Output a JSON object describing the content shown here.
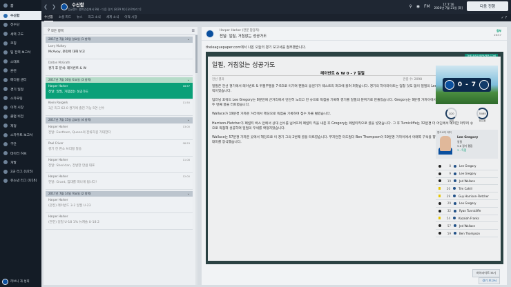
{
  "sidebar": {
    "top_label": "홈",
    "items": [
      {
        "label": "수신함",
        "icon": "inbox-icon",
        "active": true
      },
      {
        "label": "전수단",
        "icon": "squad-icon"
      },
      {
        "label": "세력 구도",
        "icon": "dynamics-icon"
      },
      {
        "label": "코칭",
        "icon": "whistle-icon"
      },
      {
        "label": "팀 전력 보고서",
        "icon": "report-icon"
      },
      {
        "label": "스태프",
        "icon": "staff-icon"
      },
      {
        "label": "훈련",
        "icon": "training-icon"
      },
      {
        "label": "메디컬 센터",
        "icon": "medical-icon"
      },
      {
        "label": "경기 일정",
        "icon": "calendar-icon"
      },
      {
        "label": "스카우팅",
        "icon": "scouting-icon"
      },
      {
        "label": "이적 시장",
        "icon": "transfers-icon"
      },
      {
        "label": "클럽 비전",
        "icon": "vision-icon"
      },
      {
        "label": "재정",
        "icon": "finance-icon"
      },
      {
        "label": "스카우트 보고서",
        "icon": "scout-report-icon"
      },
      {
        "label": "구단",
        "icon": "club-icon"
      },
      {
        "label": "데이터 허브",
        "icon": "data-icon"
      },
      {
        "label": "개발",
        "icon": "dev-icon"
      },
      {
        "label": "2군 리그 (U23)",
        "icon": "league-icon"
      },
      {
        "label": "유소년 리그 (U18)",
        "icon": "youth-league-icon"
      }
    ],
    "bottom_label": "리브니 과 성희"
  },
  "topbar": {
    "title": "수신함",
    "subtitle": "잉글랜드 챔피언십에서 8위 · 다음 경기 (8/29 화) [유로파리그]",
    "date_line1": "17:7:16",
    "date_line2": "2020년 7월 21일 [화]",
    "continue_label": "다음 진행"
  },
  "tabs": [
    "수신함",
    "소셜 피드",
    "뉴스",
    "리그 소식",
    "세계 소식",
    "이적 시장"
  ],
  "list": {
    "search_placeholder": "모든 항목",
    "groups": [
      {
        "header": "2017년 7월 16일 일요일 (1 항목)",
        "green": false,
        "messages": [
          {
            "sender": "Larry Mulkey",
            "subject": "McAvoy, 훈련에 대해 보고",
            "time": "",
            "read": false
          }
        ]
      },
      {
        "header": "",
        "green": false,
        "messages": [
          {
            "sender": "Dalton McGrath",
            "subject": "경기 후 분석: 레이번트 & W",
            "time": "",
            "read": false
          }
        ]
      },
      {
        "header": "2017년 7월 16일 토요일 (3 항목)",
        "green": true,
        "messages": [
          {
            "sender": "Harper Harker",
            "subject": "전달: 일필, 거침없는 성공가도",
            "time": "18:57",
            "read": false,
            "selected": true
          },
          {
            "sender": "Kevin Rosgerk",
            "subject": "3군 리그 62.0 경기에 출전 가능 5연 선수",
            "time": "11:50",
            "read": true
          }
        ]
      },
      {
        "header": "2017년 7월 15일 금요일 (4 항목)",
        "green": false,
        "messages": [
          {
            "sender": "Harper Harker",
            "subject": "전달: Eastham, Queen의 잔류하길 기대한다",
            "time": "13:00",
            "read": true
          },
          {
            "sender": "Paul Criver",
            "subject": "경기 전 펀소 브리핑 발송",
            "time": "08:53",
            "read": true
          },
          {
            "sender": "Harper Harker",
            "subject": "전달: Sheridan, 전방한 만큼 대표",
            "time": "11:08",
            "read": true
          },
          {
            "sender": "Harper Harker",
            "subject": "전달: Grant, 임대를 떠나게 됩니다!",
            "time": "12:00",
            "read": true
          }
        ]
      },
      {
        "header": "2017년 7월 14일 목요일 (2 항목)",
        "green": false,
        "messages": [
          {
            "sender": "Harper Harker",
            "subject": "(관전) 레이번드 3-2 일필 U-23",
            "time": "",
            "read": true
          },
          {
            "sender": "Harper Harker",
            "subject": "(관전) 일필 U-18 1% 뉴캐슬 U-18 2",
            "time": "",
            "read": true
          }
        ]
      }
    ]
  },
  "detail": {
    "from": "Harper Harker (전문 담당자)",
    "subject": "전달: 일필, 거침없는 성공가도",
    "attached_label": "첨부",
    "time": "16:57",
    "intro": "theleaguepaper.com에서 나온 오늘의 경기 보고서를 첨부했습니다.",
    "site_tag": "THELEAGUEPAPER.COM",
    "headline": "일필, 거침없는 성공가도",
    "score_line": "레이번트 & W 0 - 7 일필",
    "byline": "전선 결과",
    "rating_label": "관중 수: 2098",
    "paragraphs": [
      "일필은 전선 경기에서 레이번트 & 위필무필을 7-0으로 이기며 팬들의 응원가가 웨스트리 퍼크에 울려 퍼졌습니다. 경기의 하이라이트는 엄청 것도 없이 일필의 Lee Gregory가 기록한 해트트릭이었습니다.",
      "딥러닝 포워드 Lee Gregory는 8분만에 근거리에서 단단히 노리고 찬 슈으로 득점을 기록해 경기를 일필의 분위기로 만들었습니다. Gregory는 9분경 가까이에서 아래쪽 구석을 향한 슈으로 두 번째 골을 터트렸습니다.",
      "Wallace가 19분경 가까운 거리에서 헤딩으로 득점을 기록하며 점수 차를 벌렸습니다.",
      "Harrison-Fletcher가 페널티 박스 안에서 상대 선수를 넘어뜨려 페널티 킥을 내준 후 Gregory는 페널티킥으로 골을 넣었습니다. 그 후 Turnicliffe는 32분경 더 어딘에서 예리한 마무리 슈으로 득점해 성공하며 일필의 우세를 확정지었습니다.",
      "Wallace는 57분경 가까운 곳에서 헤딩으로 이 경기 그의 2번째 골을 터트렸습니다. 부지런한 미드필더 Ben Thompson이 59분경 가까이에서 아래쪽 구석을 향한 슈으로 득점을 기록하며 대미를 장식했습니다."
    ],
    "score_home": "0",
    "score_away": "7",
    "gauge_a_label": "슈팅",
    "gauge_a_value": "1/20",
    "gauge_b_label": "점유율",
    "gauge_b_value": "35/65",
    "motm_title": "맨오브더 매치",
    "motm_name": "Lee Gregory",
    "motm_club": "일필",
    "motm_rating": "9.6 경기 평점",
    "motm_goals": "3 - 득점",
    "events": [
      {
        "min": "8",
        "player": "Lee Gregory",
        "type": "goal"
      },
      {
        "min": "9",
        "player": "Lee Gregory",
        "type": "goal"
      },
      {
        "min": "19",
        "player": "Jed Wallace",
        "type": "goal"
      },
      {
        "min": "20",
        "player": "Tim Cahill",
        "type": "yellow"
      },
      {
        "min": "29",
        "player": "Guy Harrison-Fletcher",
        "type": "yellow"
      },
      {
        "min": "29",
        "player": "Lee Gregory",
        "type": "goal"
      },
      {
        "min": "32",
        "player": "Ryan Tunnicliffe",
        "type": "goal"
      },
      {
        "min": "54",
        "player": "Kazaiah Franks",
        "type": "yellow"
      },
      {
        "min": "57",
        "player": "Jed Wallace",
        "type": "goal"
      },
      {
        "min": "59",
        "player": "Ben Thompson",
        "type": "goal"
      }
    ],
    "footer_btn": "하이라이트 보기",
    "footer_btn2": "경기 보고서"
  }
}
